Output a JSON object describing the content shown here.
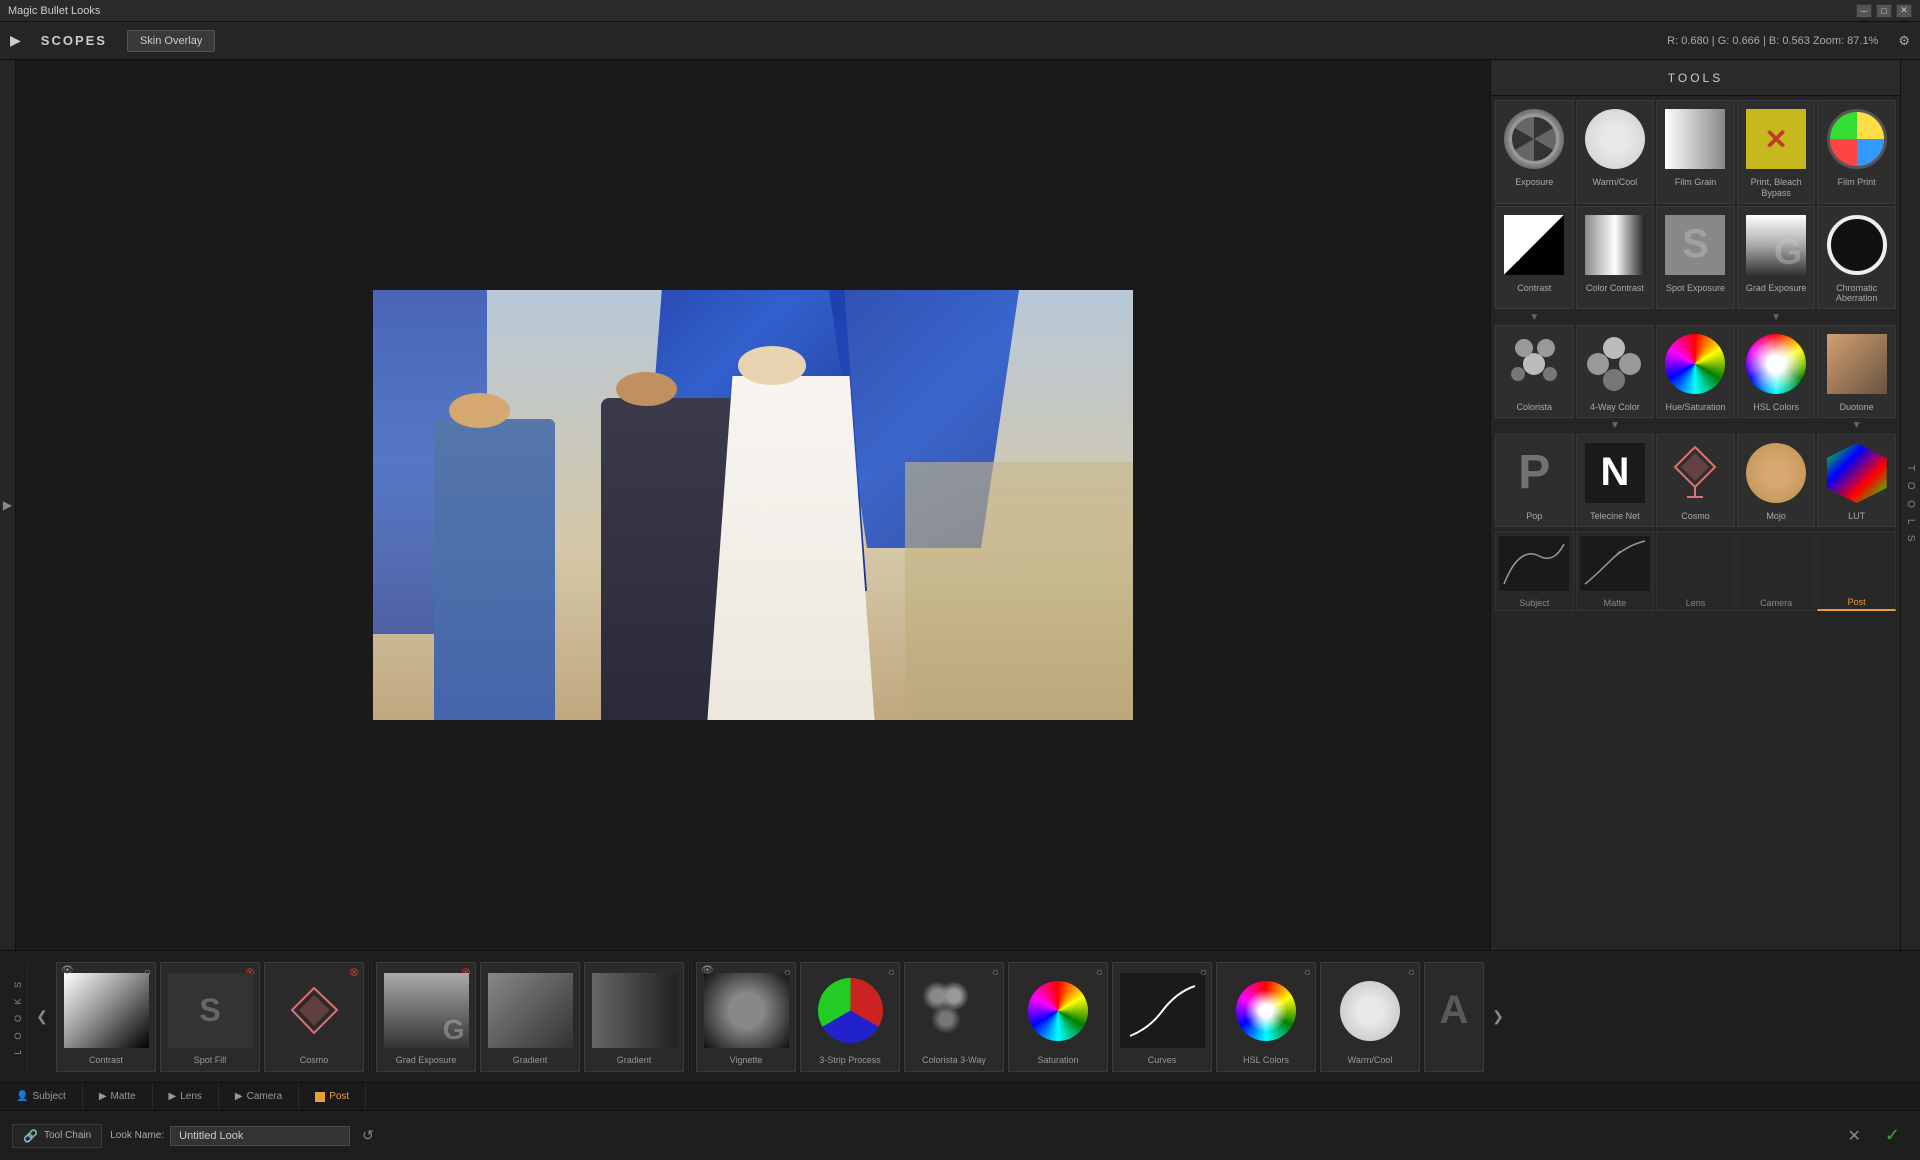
{
  "titlebar": {
    "title": "Magic Bullet Looks",
    "min_label": "─",
    "max_label": "□",
    "close_label": "✕"
  },
  "topbar": {
    "nav_arrow": "▶",
    "scopes_label": "SCOPES",
    "skin_overlay": "Skin Overlay",
    "color_info": "R: 0.680  |  G: 0.666  |  B: 0.563    Zoom: 87.1%",
    "settings_icon": "⚙"
  },
  "tools": {
    "header": "TOOLS",
    "rows": [
      [
        {
          "id": "exposure",
          "label": "Exposure"
        },
        {
          "id": "warm_cool",
          "label": "Warm/Cool"
        },
        {
          "id": "film_grain",
          "label": "Film Grain"
        },
        {
          "id": "print_bleach_bypass",
          "label": "Print, Bleach Bypass"
        },
        {
          "id": "film_print",
          "label": "Film Print"
        }
      ],
      [
        {
          "id": "contrast",
          "label": "Contrast"
        },
        {
          "id": "color_contrast",
          "label": "Color Contrast"
        },
        {
          "id": "spot_exposure",
          "label": "Spot Exposure"
        },
        {
          "id": "grad_exposure",
          "label": "Grad Exposure"
        },
        {
          "id": "chromatic_aberration",
          "label": "Chromatic Aberration"
        }
      ],
      [
        {
          "id": "colorista",
          "label": "Colorista"
        },
        {
          "id": "four_way_color",
          "label": "4-Way Color"
        },
        {
          "id": "hue_saturation",
          "label": "Hue/Saturation"
        },
        {
          "id": "hsl_colors",
          "label": "HSL Colors"
        },
        {
          "id": "duotone",
          "label": "Duotone"
        }
      ],
      [
        {
          "id": "pop",
          "label": "Pop"
        },
        {
          "id": "telecine_net",
          "label": "Telecine Net"
        },
        {
          "id": "cosmo",
          "label": "Cosmo"
        },
        {
          "id": "mojo",
          "label": "Mojo"
        },
        {
          "id": "lut",
          "label": "LUT"
        }
      ]
    ],
    "section_tabs": [
      {
        "id": "subject",
        "label": "Subject"
      },
      {
        "id": "matte",
        "label": "Matte"
      },
      {
        "id": "lens",
        "label": "Lens"
      },
      {
        "id": "camera",
        "label": "Camera"
      },
      {
        "id": "post",
        "label": "Post",
        "active": true
      }
    ]
  },
  "filmstrip": {
    "left_arrow": "❮",
    "right_arrow": "❯",
    "items": [
      {
        "id": "contrast",
        "label": "Contrast",
        "has_eye": true,
        "has_close": true,
        "close_color": "gray"
      },
      {
        "id": "spot_fill",
        "label": "Spot Fill",
        "has_eye": false,
        "has_close": true,
        "close_color": "red"
      },
      {
        "id": "cosmo_film",
        "label": "Cosmo",
        "has_eye": false,
        "has_close": true,
        "close_color": "red"
      },
      {
        "id": "spacer1",
        "spacer": true
      },
      {
        "id": "grad_exposure_film",
        "label": "Grad Exposure",
        "has_eye": false,
        "has_close": true,
        "close_color": "red"
      },
      {
        "id": "gradient1",
        "label": "Gradient",
        "has_eye": false,
        "has_close": false,
        "close_color": "none"
      },
      {
        "id": "gradient2",
        "label": "Gradient",
        "has_eye": false,
        "has_close": false,
        "close_color": "none"
      },
      {
        "id": "spacer2",
        "spacer": true
      },
      {
        "id": "vignette",
        "label": "Vignette",
        "has_eye": true,
        "has_close": true,
        "close_color": "gray"
      },
      {
        "id": "three_strip",
        "label": "3-Strip Process",
        "has_eye": false,
        "has_close": true,
        "close_color": "gray"
      },
      {
        "id": "colorista_3way",
        "label": "Colorista 3-Way",
        "has_eye": false,
        "has_close": true,
        "close_color": "gray"
      },
      {
        "id": "saturation_film",
        "label": "Saturation",
        "has_eye": false,
        "has_close": true,
        "close_color": "gray"
      },
      {
        "id": "curves_film",
        "label": "Curves",
        "has_eye": false,
        "has_close": true,
        "close_color": "gray"
      },
      {
        "id": "hsl_colors_film",
        "label": "HSL Colors",
        "has_eye": false,
        "has_close": true,
        "close_color": "gray"
      },
      {
        "id": "warm_cool_film",
        "label": "Warm/Cool",
        "has_eye": false,
        "has_close": true,
        "close_color": "gray"
      },
      {
        "id": "a_item",
        "label": "",
        "has_eye": false,
        "has_close": false,
        "close_color": "none"
      }
    ]
  },
  "section_labels": [
    {
      "id": "subject",
      "label": "Subject",
      "icon": "👤"
    },
    {
      "id": "matte",
      "label": "Matte",
      "icon": "▶"
    },
    {
      "id": "lens",
      "label": "Lens",
      "icon": "▶"
    },
    {
      "id": "camera",
      "label": "Camera",
      "icon": "▶"
    },
    {
      "id": "post",
      "label": "Post",
      "icon": "🟡",
      "active": true
    }
  ],
  "bottom_toolbar": {
    "toolchain_label": "Tool Chain",
    "chain_icon": "🔗",
    "lookname_label": "Look Name:",
    "lookname_value": "Untitled Look",
    "reset_icon": "↺",
    "close_icon": "✕",
    "check_icon": "✓"
  }
}
